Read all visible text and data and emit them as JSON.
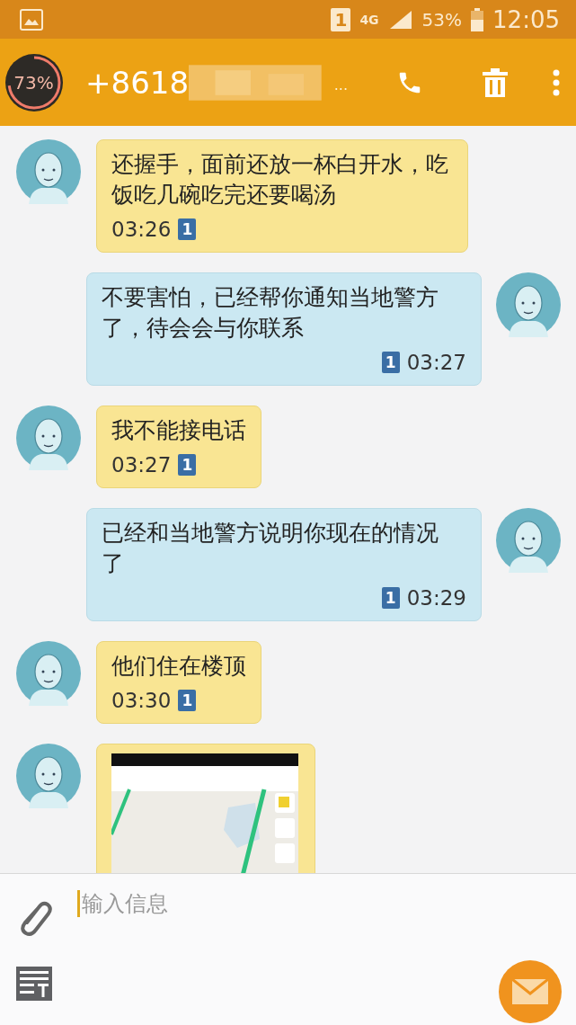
{
  "status_bar": {
    "sim": "1",
    "network": "4G",
    "battery": "53%",
    "time": "12:05"
  },
  "app_bar": {
    "badge": {
      "reading": "73%"
    },
    "title": "+8618",
    "title_tail": "..."
  },
  "messages": [
    {
      "kind": "text",
      "outgoing": false,
      "text": "还握手，面前还放一杯白开水，吃饭吃几碗吃完还要喝汤",
      "time": "03:26",
      "sim": "1"
    },
    {
      "kind": "text",
      "outgoing": true,
      "text": "不要害怕，已经帮你通知当地警方了，待会会与你联系",
      "time": "03:27",
      "sim": "1"
    },
    {
      "kind": "text",
      "outgoing": false,
      "text": "我不能接电话",
      "time": "03:27",
      "sim": "1"
    },
    {
      "kind": "text",
      "outgoing": true,
      "text": "已经和当地警方说明你现在的情况了",
      "time": "03:29",
      "sim": "1"
    },
    {
      "kind": "text",
      "outgoing": false,
      "text": "他们住在楼顶",
      "time": "03:30",
      "sim": "1"
    },
    {
      "kind": "picture",
      "outgoing": false
    }
  ],
  "composer": {
    "placeholder": "输入信息"
  }
}
